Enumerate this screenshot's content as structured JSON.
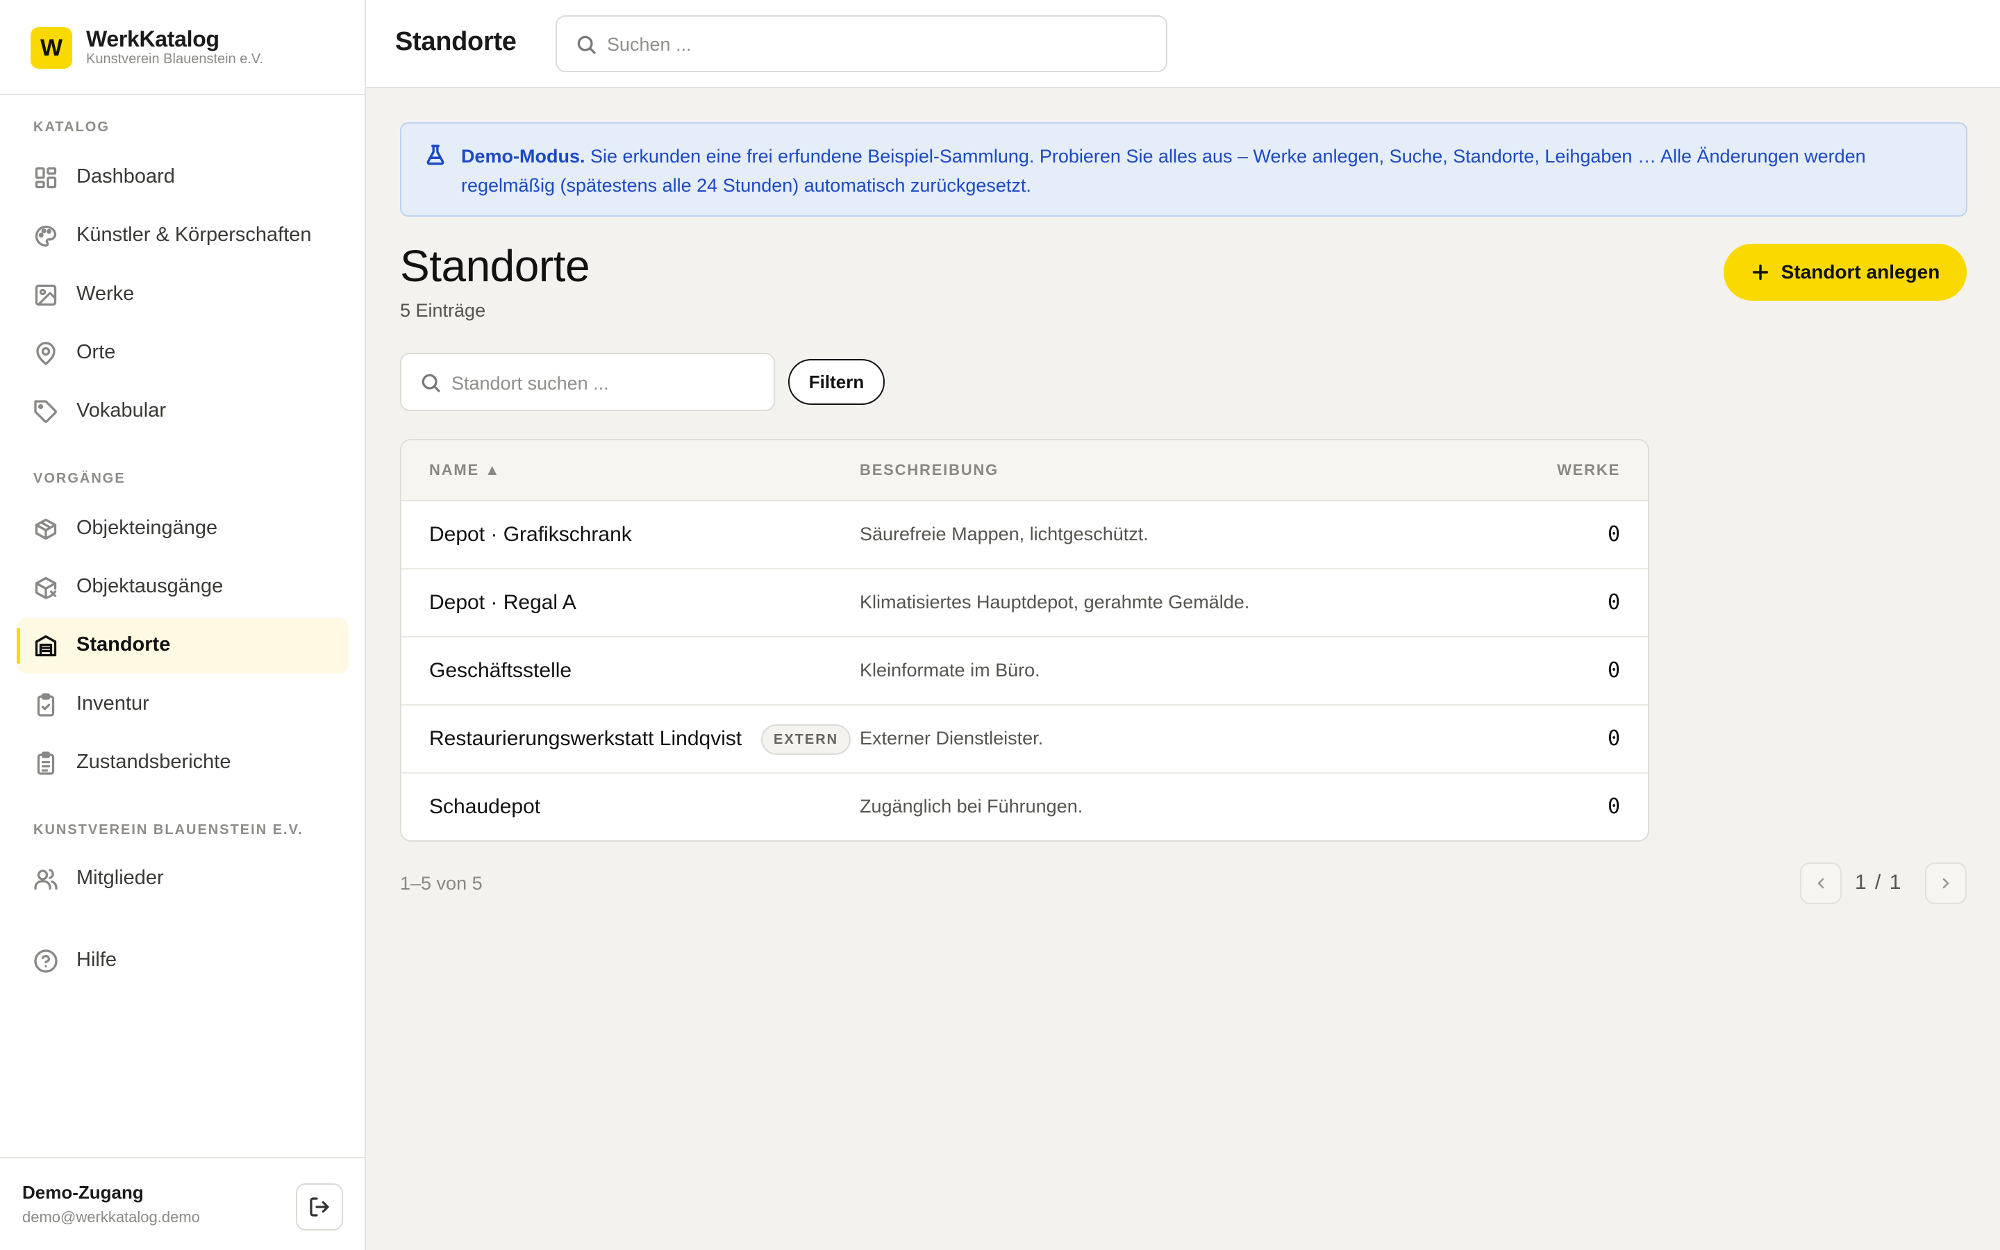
{
  "brand": {
    "logo_letter": "W",
    "name": "WerkKatalog",
    "org": "Kunstverein Blauenstein e.V."
  },
  "sidebar": {
    "sections": [
      {
        "label": "KATALOG"
      },
      {
        "label": "VORGÄNGE"
      },
      {
        "label": "KUNSTVEREIN BLAUENSTEIN E.V."
      }
    ],
    "items": [
      {
        "label": "Dashboard",
        "icon": "dashboard-grid-icon"
      },
      {
        "label": "Künstler & Körperschaften",
        "icon": "palette-icon"
      },
      {
        "label": "Werke",
        "icon": "image-icon"
      },
      {
        "label": "Orte",
        "icon": "map-pin-icon"
      },
      {
        "label": "Vokabular",
        "icon": "tag-icon"
      },
      {
        "label": "Objekteingänge",
        "icon": "package-in-icon"
      },
      {
        "label": "Objektausgänge",
        "icon": "package-out-icon"
      },
      {
        "label": "Standorte",
        "icon": "warehouse-icon",
        "active": true
      },
      {
        "label": "Inventur",
        "icon": "clipboard-check-icon"
      },
      {
        "label": "Zustandsberichte",
        "icon": "clipboard-list-icon"
      },
      {
        "label": "Mitglieder",
        "icon": "users-icon"
      },
      {
        "label": "Hilfe",
        "icon": "help-circle-icon"
      }
    ],
    "user": {
      "name": "Demo-Zugang",
      "email": "demo@werkkatalog.demo"
    }
  },
  "header": {
    "title": "Standorte",
    "search_placeholder": "Suchen ..."
  },
  "banner": {
    "strong": "Demo-Modus.",
    "text": " Sie erkunden eine frei erfundene Beispiel-Sammlung. Probieren Sie alles aus – Werke anlegen, Suche, Standorte, Leihgaben … Alle Änderungen werden regelmäßig (spätestens alle 24 Stunden) automatisch zurückgesetzt."
  },
  "page": {
    "title": "Standorte",
    "count_text": "5 Einträge",
    "add_button": "Standort anlegen",
    "search_placeholder": "Standort suchen ...",
    "filter_button": "Filtern"
  },
  "table": {
    "columns": {
      "name": "NAME ▲",
      "description": "BESCHREIBUNG",
      "works": "WERKE"
    },
    "rows": [
      {
        "name": "Depot · Grafikschrank",
        "badge": "",
        "description": "Säurefreie Mappen, lichtgeschützt.",
        "works": "0"
      },
      {
        "name": "Depot · Regal A",
        "badge": "",
        "description": "Klimatisiertes Hauptdepot, gerahmte Gemälde.",
        "works": "0"
      },
      {
        "name": "Geschäftsstelle",
        "badge": "",
        "description": "Kleinformate im Büro.",
        "works": "0"
      },
      {
        "name": "Restaurierungswerkstatt Lindqvist",
        "badge": "EXTERN",
        "description": "Externer Dienstleister.",
        "works": "0"
      },
      {
        "name": "Schaudepot",
        "badge": "",
        "description": "Zugänglich bei Führungen.",
        "works": "0"
      }
    ]
  },
  "pagination": {
    "range_text": "1–5 von 5",
    "page_text": "1 / 1"
  },
  "colors": {
    "accent": "#f9d900",
    "banner_text": "#1d49c4",
    "banner_bg": "#e4edf8",
    "page_bg": "#f3f2ee"
  }
}
